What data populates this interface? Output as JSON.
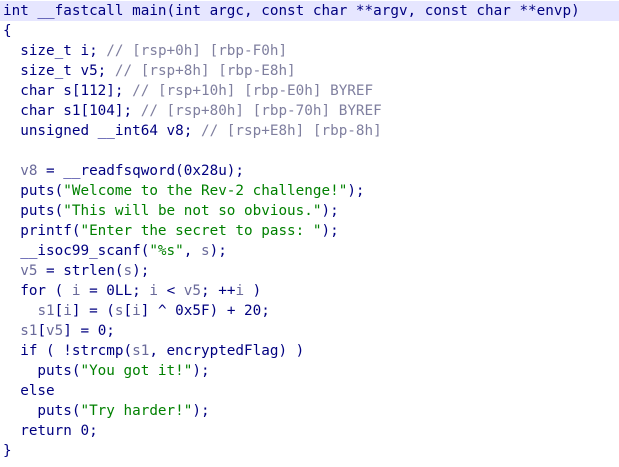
{
  "pseudocode": {
    "lines": [
      {
        "highlight": true,
        "segments": [
          {
            "t": "int __fastcall main(int argc, const char **argv, const char **envp)",
            "c": "plain"
          }
        ]
      },
      {
        "segments": [
          {
            "t": "{",
            "c": "plain"
          }
        ]
      },
      {
        "segments": [
          {
            "t": "  size_t i; ",
            "c": "plain"
          },
          {
            "t": "// [rsp+0h] [rbp-F0h]",
            "c": "cmt"
          }
        ]
      },
      {
        "segments": [
          {
            "t": "  size_t v5; ",
            "c": "plain"
          },
          {
            "t": "// [rsp+8h] [rbp-E8h]",
            "c": "cmt"
          }
        ]
      },
      {
        "segments": [
          {
            "t": "  char s[112]; ",
            "c": "plain"
          },
          {
            "t": "// [rsp+10h] [rbp-E0h] BYREF",
            "c": "cmt"
          }
        ]
      },
      {
        "segments": [
          {
            "t": "  char s1[104]; ",
            "c": "plain"
          },
          {
            "t": "// [rsp+80h] [rbp-70h] BYREF",
            "c": "cmt"
          }
        ]
      },
      {
        "segments": [
          {
            "t": "  unsigned __int64 v8; ",
            "c": "plain"
          },
          {
            "t": "// [rsp+E8h] [rbp-8h]",
            "c": "cmt"
          }
        ]
      },
      {
        "segments": [
          {
            "t": "",
            "c": "plain"
          }
        ]
      },
      {
        "segments": [
          {
            "t": "  ",
            "c": "plain"
          },
          {
            "t": "v8",
            "c": "local"
          },
          {
            "t": " = __readfsqword(0x28u);",
            "c": "plain"
          }
        ]
      },
      {
        "segments": [
          {
            "t": "  puts(",
            "c": "plain"
          },
          {
            "t": "\"Welcome to the Rev-2 challenge!\"",
            "c": "str"
          },
          {
            "t": ");",
            "c": "plain"
          }
        ]
      },
      {
        "segments": [
          {
            "t": "  puts(",
            "c": "plain"
          },
          {
            "t": "\"This will be not so obvious.\"",
            "c": "str"
          },
          {
            "t": ");",
            "c": "plain"
          }
        ]
      },
      {
        "segments": [
          {
            "t": "  printf(",
            "c": "plain"
          },
          {
            "t": "\"Enter the secret to pass: \"",
            "c": "str"
          },
          {
            "t": ");",
            "c": "plain"
          }
        ]
      },
      {
        "segments": [
          {
            "t": "  __isoc99_scanf(",
            "c": "plain"
          },
          {
            "t": "\"%s\"",
            "c": "str"
          },
          {
            "t": ", ",
            "c": "plain"
          },
          {
            "t": "s",
            "c": "local"
          },
          {
            "t": ");",
            "c": "plain"
          }
        ]
      },
      {
        "segments": [
          {
            "t": "  ",
            "c": "plain"
          },
          {
            "t": "v5",
            "c": "local"
          },
          {
            "t": " = strlen(",
            "c": "plain"
          },
          {
            "t": "s",
            "c": "local"
          },
          {
            "t": ");",
            "c": "plain"
          }
        ]
      },
      {
        "segments": [
          {
            "t": "  for ( ",
            "c": "plain"
          },
          {
            "t": "i",
            "c": "local"
          },
          {
            "t": " = 0LL; ",
            "c": "plain"
          },
          {
            "t": "i",
            "c": "local"
          },
          {
            "t": " < ",
            "c": "plain"
          },
          {
            "t": "v5",
            "c": "local"
          },
          {
            "t": "; ++",
            "c": "plain"
          },
          {
            "t": "i",
            "c": "local"
          },
          {
            "t": " )",
            "c": "plain"
          }
        ]
      },
      {
        "segments": [
          {
            "t": "    ",
            "c": "plain"
          },
          {
            "t": "s1",
            "c": "local"
          },
          {
            "t": "[",
            "c": "plain"
          },
          {
            "t": "i",
            "c": "local"
          },
          {
            "t": "] = (",
            "c": "plain"
          },
          {
            "t": "s",
            "c": "local"
          },
          {
            "t": "[",
            "c": "plain"
          },
          {
            "t": "i",
            "c": "local"
          },
          {
            "t": "] ^ 0x5F) + 20;",
            "c": "plain"
          }
        ]
      },
      {
        "segments": [
          {
            "t": "  ",
            "c": "plain"
          },
          {
            "t": "s1",
            "c": "local"
          },
          {
            "t": "[",
            "c": "plain"
          },
          {
            "t": "v5",
            "c": "local"
          },
          {
            "t": "] = 0;",
            "c": "plain"
          }
        ]
      },
      {
        "segments": [
          {
            "t": "  if ( !strcmp(",
            "c": "plain"
          },
          {
            "t": "s1",
            "c": "local"
          },
          {
            "t": ", encryptedFlag) )",
            "c": "plain"
          }
        ]
      },
      {
        "segments": [
          {
            "t": "    puts(",
            "c": "plain"
          },
          {
            "t": "\"You got it!\"",
            "c": "str"
          },
          {
            "t": ");",
            "c": "plain"
          }
        ]
      },
      {
        "segments": [
          {
            "t": "  else",
            "c": "plain"
          }
        ]
      },
      {
        "segments": [
          {
            "t": "    puts(",
            "c": "plain"
          },
          {
            "t": "\"Try harder!\"",
            "c": "str"
          },
          {
            "t": ");",
            "c": "plain"
          }
        ]
      },
      {
        "segments": [
          {
            "t": "  return 0;",
            "c": "plain"
          }
        ]
      },
      {
        "segments": [
          {
            "t": "}",
            "c": "plain"
          }
        ]
      }
    ]
  },
  "colors": {
    "background": "#ffffff",
    "code": "#000080",
    "string": "#008000",
    "comment": "#7f7f9f",
    "local_var": "#6a6a9a",
    "current_line": "#e6e6ff"
  }
}
